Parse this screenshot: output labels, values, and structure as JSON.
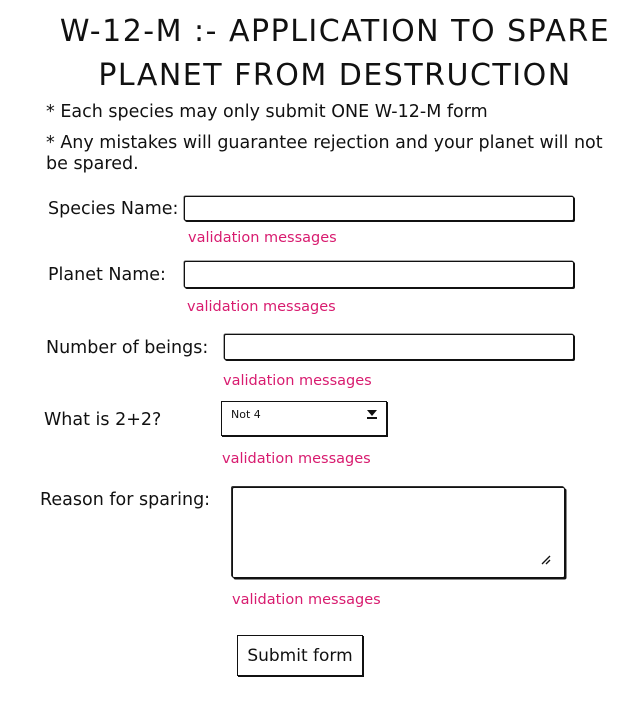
{
  "title": {
    "line1": "W-12-M :- APPLICATION TO SPARE",
    "line2": "PLANET FROM DESTRUCTION"
  },
  "rules": [
    "* Each species may only submit ONE W-12-M form",
    "* Any mistakes will guarantee rejection and your planet will not be spared."
  ],
  "form": {
    "species": {
      "label": "Species Name:",
      "value": "",
      "validation": "validation messages"
    },
    "planet": {
      "label": "Planet Name:",
      "value": "",
      "validation": "validation messages"
    },
    "beings": {
      "label": "Number of beings:",
      "value": "",
      "validation": "validation messages"
    },
    "math": {
      "label": "What is 2+2?",
      "selected": "Not 4",
      "validation": "validation messages"
    },
    "reason": {
      "label": "Reason for sparing:",
      "value": "",
      "validation": "validation messages"
    },
    "submit_label": "Submit form"
  },
  "colors": {
    "validation": "#d81b6f",
    "ink": "#111111"
  },
  "icons": {
    "select_caret": "chevron-down-icon",
    "textarea_grip": "resize-grip-icon"
  }
}
